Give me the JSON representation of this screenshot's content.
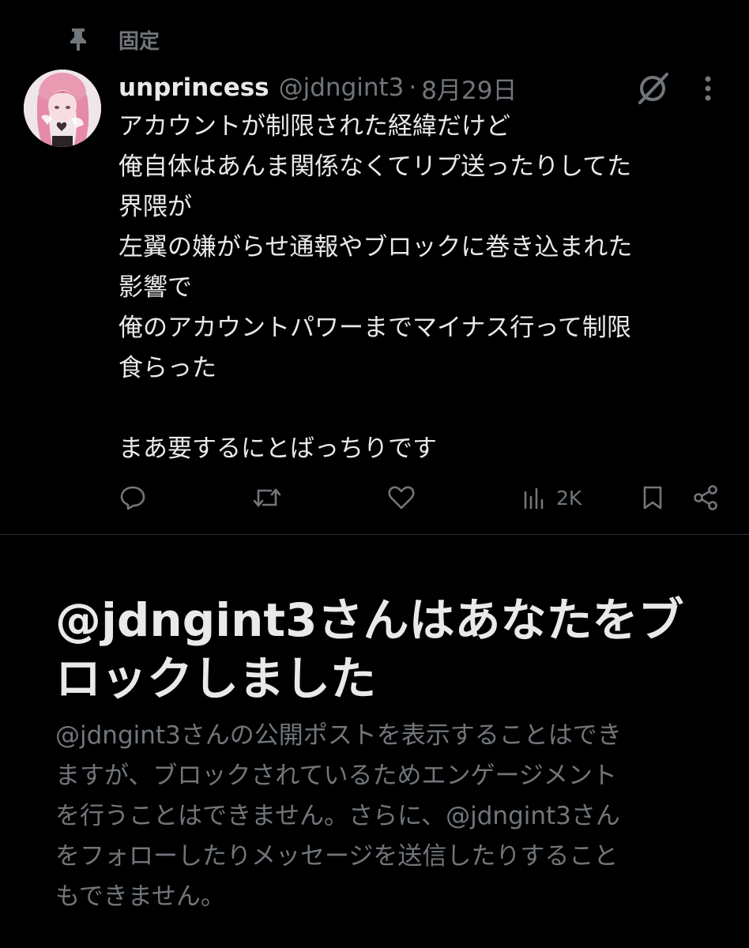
{
  "pinned": {
    "label": "固定",
    "icon": "pin-icon"
  },
  "post": {
    "author": {
      "display_name": "unprincess",
      "handle": "@jdngint3",
      "avatar_icon": "avatar-anime-pink-hair"
    },
    "separator": "·",
    "date": "8月29日",
    "body_lines": [
      "アカウントが制限された経緯だけど",
      "俺自体はあんま関係なくてリプ送ったりしてた",
      "界隈が",
      "左翼の嫌がらせ通報やブロックに巻き込まれた",
      "影響で",
      "俺のアカウントパワーまでマイナス行って制限",
      "食らった",
      "",
      "まあ要するにとばっちりです"
    ],
    "actions": {
      "reply_icon": "reply-icon",
      "repost_icon": "repost-icon",
      "like_icon": "like-icon",
      "views_icon": "views-icon",
      "views_count": "2K",
      "bookmark_icon": "bookmark-icon",
      "share_icon": "share-icon"
    },
    "header_icons": {
      "grok": "grok-icon",
      "more": "more-icon"
    }
  },
  "blocked_notice": {
    "title_lines": [
      "@jdngint3さんはあなたをブ",
      "ロックしました"
    ],
    "description_lines": [
      "@jdngint3さんの公開ポストを表示することはでき",
      "ますが、ブロックされているためエンゲージメント",
      "を行うことはできません。さらに、@jdngint3さん",
      "をフォローしたりメッセージを送信したりすること",
      "もできません。"
    ]
  },
  "colors": {
    "background": "#000000",
    "primary_text": "#e7e9ea",
    "secondary_text": "#71767b",
    "divider": "#2f3336"
  }
}
